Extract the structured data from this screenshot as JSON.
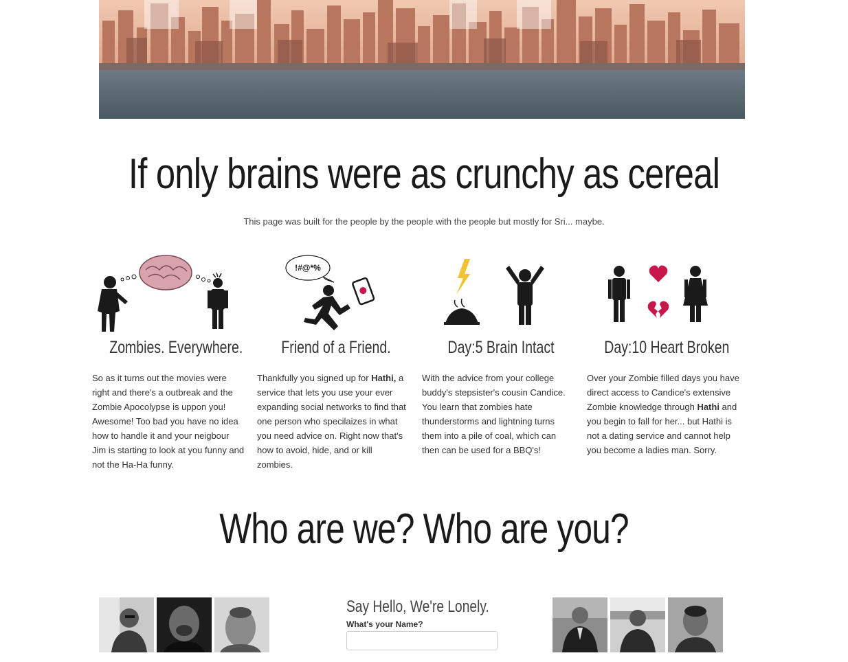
{
  "hero": {
    "alt": "city skyline banner"
  },
  "main_title": "If only brains were as crunchy as cereal",
  "subtitle": "This page was built for the people by the people with the people but mostly for Sri... maybe.",
  "features": [
    {
      "heading": "Zombies. Everywhere.",
      "icon": "zombie-brain-icon",
      "text_parts": [
        "So as it turns out the movies were right and there's a outbreak and the Zombie Apocolypse is uppon you! Awesome! Too bad you have no idea how to handle it and your neigbour Jim is starting to look at you funny and not the Ha-Ha funny."
      ]
    },
    {
      "heading": "Friend of a Friend.",
      "icon": "running-phone-icon",
      "speech": "!#@*%",
      "text_before": "Thankfully you signed up for ",
      "text_bold": "Hathi,",
      "text_after": " a service that lets you use your ever expanding social networks to find that one person who specilaizes in what you need advice on. Right now that's how to avoid, hide, and or kill zombies."
    },
    {
      "heading": "Day:5   Brain Intact",
      "icon": "lightning-coal-icon",
      "text_parts": [
        "With the advice from your college buddy's stepsister's cousin Candice. You learn that zombies hate thunderstorms and lightning turns them into a pile of coal, which can then can be used for a BBQ's!"
      ]
    },
    {
      "heading": "Day:10   Heart Broken",
      "icon": "broken-heart-icon",
      "text_before": "Over your Zombie filled days you have direct access to Candice's extensive Zombie knowledge through ",
      "text_bold": "Hathi",
      "text_after": " and you begin to fall for her... but Hathi is not a dating service and cannot help you become a ladies man. Sorry."
    }
  ],
  "who_title": "Who are we? Who are you?",
  "contact": {
    "heading": "Say Hello, We're Lonely.",
    "name_label": "What's your Name?",
    "name_value": ""
  },
  "colors": {
    "accent_red": "#c8174b",
    "lightning": "#f1c232",
    "brain": "#d9a3ad"
  }
}
